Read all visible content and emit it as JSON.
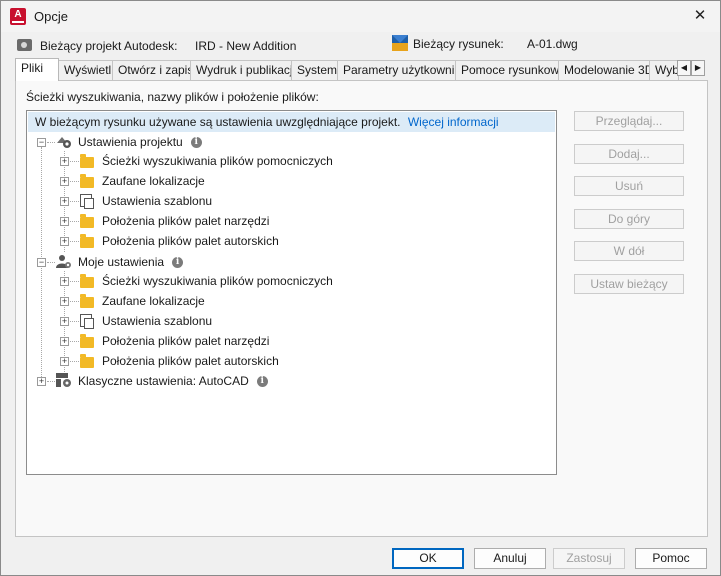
{
  "window": {
    "title": "Opcje"
  },
  "header": {
    "project_label": "Bieżący projekt Autodesk:",
    "project_value": "IRD - New Addition",
    "drawing_label": "Bieżący rysunek:",
    "drawing_value": "A-01.dwg"
  },
  "tabs": [
    {
      "label": "Pliki",
      "active": true
    },
    {
      "label": "Wyświetl"
    },
    {
      "label": "Otwórz i zapisz"
    },
    {
      "label": "Wydruk i publikacja"
    },
    {
      "label": "System"
    },
    {
      "label": "Parametry użytkownika"
    },
    {
      "label": "Pomoce rysunkowe"
    },
    {
      "label": "Modelowanie 3D"
    },
    {
      "label": "Wybór"
    }
  ],
  "panel": {
    "label": "Ścieżki wyszukiwania, nazwy plików i położenie plików:"
  },
  "tree": {
    "banner_text": "W bieżącym rysunku używane są ustawienia uwzględniające projekt.",
    "banner_link": "Więcej informacji",
    "groups": [
      {
        "label": "Ustawienia projektu",
        "children": [
          "Ścieżki wyszukiwania plików pomocniczych",
          "Zaufane lokalizacje",
          "Ustawienia szablonu",
          "Położenia plików palet narzędzi",
          "Położenia plików palet autorskich"
        ]
      },
      {
        "label": "Moje ustawienia",
        "children": [
          "Ścieżki wyszukiwania plików pomocniczych",
          "Zaufane lokalizacje",
          "Ustawienia szablonu",
          "Położenia plików palet narzędzi",
          "Położenia plików palet autorskich"
        ]
      },
      {
        "label": "Klasyczne ustawienia: AutoCAD",
        "children": []
      }
    ]
  },
  "side_buttons": {
    "browse": "Przeglądaj...",
    "add": "Dodaj...",
    "remove": "Usuń",
    "move_up": "Do góry",
    "move_down": "W dół",
    "set_current": "Ustaw bieżący"
  },
  "bottom_buttons": {
    "ok": "OK",
    "cancel": "Anuluj",
    "apply": "Zastosuj",
    "help": "Pomoc"
  },
  "info_icon_glyph": "i"
}
